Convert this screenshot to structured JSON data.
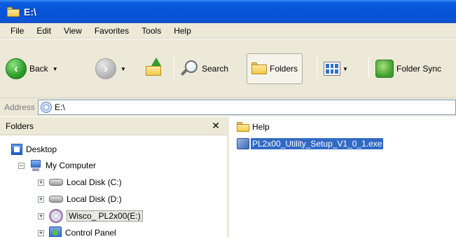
{
  "window": {
    "title": "E:\\"
  },
  "menu": [
    "File",
    "Edit",
    "View",
    "Favorites",
    "Tools",
    "Help"
  ],
  "toolbar": {
    "back_label": "Back",
    "search_label": "Search",
    "folders_label": "Folders",
    "sync_label": "Folder Sync"
  },
  "address": {
    "label": "Address",
    "value": "E:\\"
  },
  "folders_pane": {
    "title": "Folders",
    "close_glyph": "✕",
    "items": [
      {
        "label": "Desktop"
      },
      {
        "label": "My Computer",
        "expander": "⊟"
      },
      {
        "label": "Local Disk (C:)",
        "expander": "+"
      },
      {
        "label": "Local Disk (D:)",
        "expander": "+"
      },
      {
        "label": "Wisco_ PL2x00(E:)",
        "expander": "+"
      },
      {
        "label": "Control Panel",
        "expander": "+"
      }
    ]
  },
  "content": {
    "items": [
      {
        "label": "Help",
        "type": "folder"
      },
      {
        "label": "PL2x00_Utility_Setup_V1_0_1.exe",
        "type": "exe",
        "selected": true
      }
    ]
  }
}
